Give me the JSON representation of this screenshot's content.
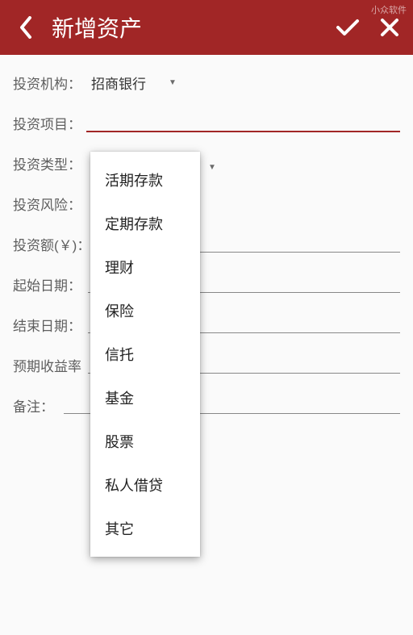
{
  "header": {
    "title": "新增资产",
    "watermark": "小众软件"
  },
  "form": {
    "institution": {
      "label": "投资机构：",
      "value": "招商银行"
    },
    "project": {
      "label": "投资项目：",
      "value": ""
    },
    "type": {
      "label": "投资类型："
    },
    "risk": {
      "label": "投资风险："
    },
    "amount": {
      "label": "投资额(￥)："
    },
    "startDate": {
      "label": "起始日期："
    },
    "endDate": {
      "label": "结束日期："
    },
    "yield": {
      "label": "预期收益率"
    },
    "remark": {
      "label": "备注："
    }
  },
  "dropdown": {
    "items": [
      "活期存款",
      "定期存款",
      "理财",
      "保险",
      "信托",
      "基金",
      "股票",
      "私人借贷",
      "其它"
    ]
  }
}
